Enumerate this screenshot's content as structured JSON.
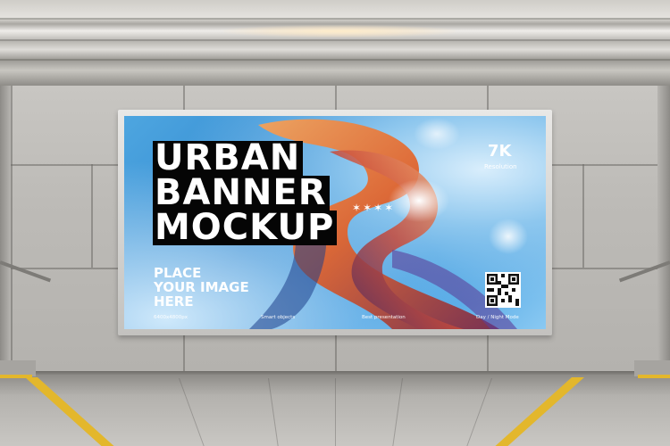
{
  "poster": {
    "title_lines": [
      "URBAN",
      "BANNER",
      "MOCKUP"
    ],
    "stars": "✶✶✶✶",
    "resolution_value": "7K",
    "resolution_label": "Resolution",
    "place_lines": [
      "PLACE",
      "YOUR IMAGE",
      "HERE"
    ],
    "footer": [
      "6400x4800px",
      "Smart objects",
      "Best presentation",
      "Day / Night Mode"
    ]
  },
  "icons": {
    "qr": "qr-code-icon"
  },
  "colors": {
    "poster_blue": "#2f86cf",
    "swirl_orange": "#e8773a",
    "floor_stripe": "#e3b72c",
    "title_box": "#050505"
  }
}
